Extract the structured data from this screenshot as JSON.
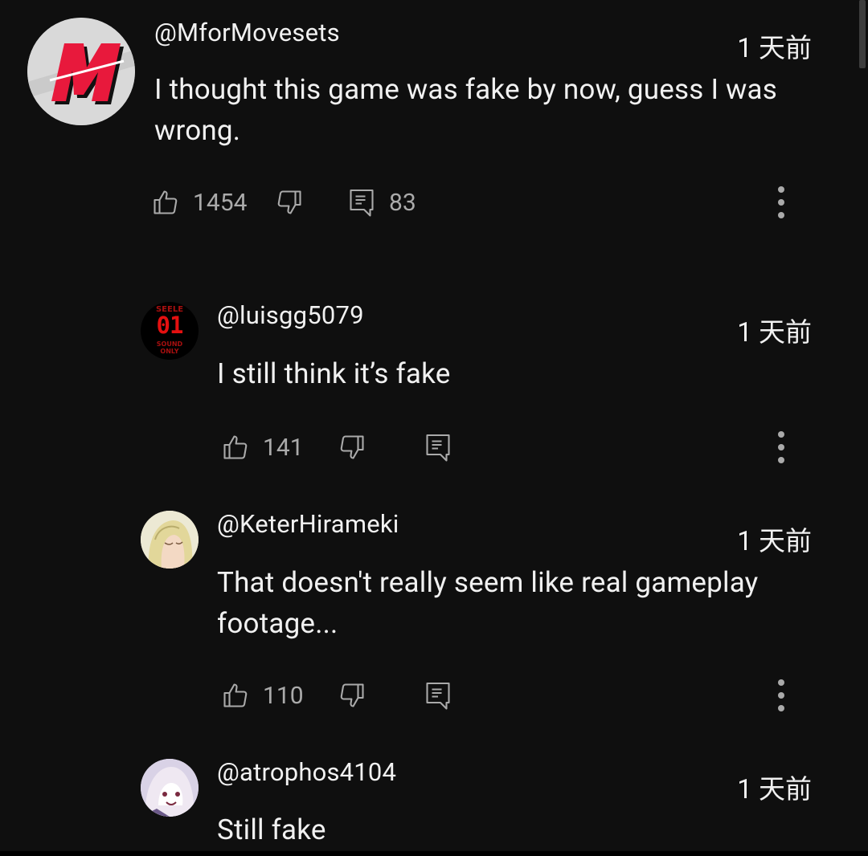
{
  "colors": {
    "background": "#0f0f0f",
    "text": "#f1f1f1",
    "secondary": "#aaaaaa",
    "brand_red": "#e8193c"
  },
  "comments": [
    {
      "author": "@MforMovesets",
      "time": "1 天前",
      "text": "I thought this game was fake by now, guess I was wrong.",
      "likes": "1454",
      "replies": "83",
      "avatar_icon": "m-logo-avatar"
    },
    {
      "author": "@luisgg5079",
      "time": "1 天前",
      "text": "I still think it’s fake",
      "likes": "141",
      "avatar_icon": "seele-avatar",
      "avatar_text": {
        "top": "SEELE",
        "number": "01",
        "bottom_line1": "SOUND",
        "bottom_line2": "ONLY"
      }
    },
    {
      "author": "@KeterHirameki",
      "time": "1 天前",
      "text": "That doesn't really seem like real gameplay footage...",
      "likes": "110",
      "avatar_icon": "anime-character-avatar"
    },
    {
      "author": "@atrophos4104",
      "time": "1 天前",
      "text": "Still fake",
      "avatar_icon": "anime-character-avatar"
    }
  ]
}
